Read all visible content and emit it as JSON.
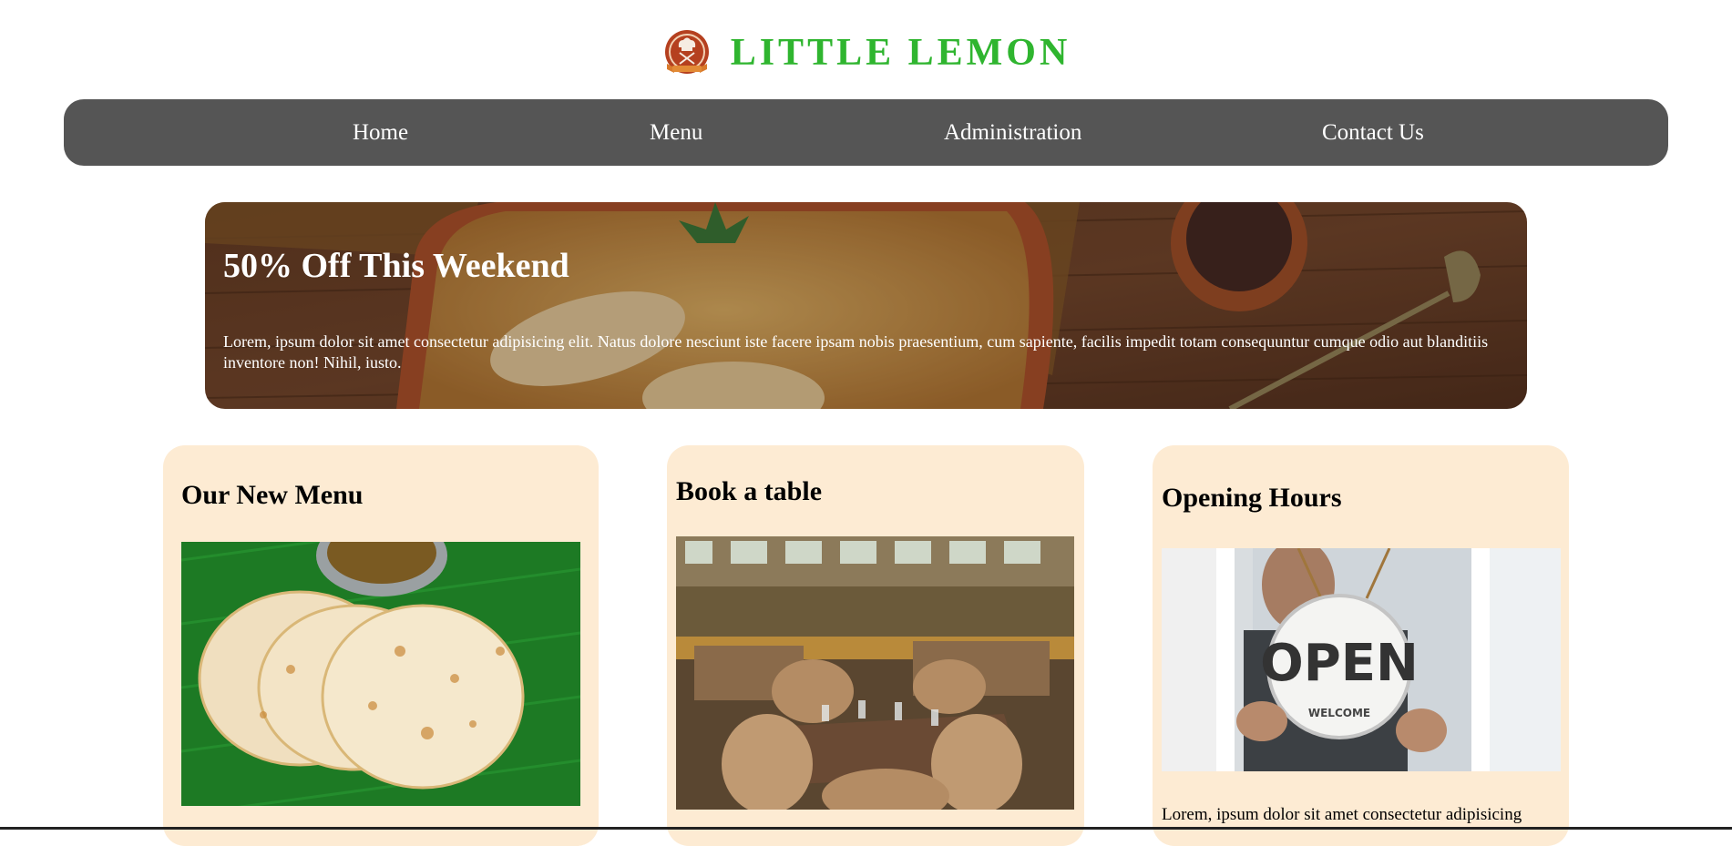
{
  "brand": {
    "name": "LITTLE LEMON",
    "logo_icon": "chef-logo-icon",
    "color": "#2fb52f"
  },
  "nav": {
    "items": [
      {
        "label": "Home"
      },
      {
        "label": "Menu"
      },
      {
        "label": "Administration"
      },
      {
        "label": "Contact Us"
      }
    ],
    "background": "#555555"
  },
  "banner": {
    "title": "50% Off This Weekend",
    "text": "Lorem, ipsum dolor sit amet consectetur adipisicing elit. Natus dolore nesciunt iste facere ipsam nobis praesentium, cum sapiente, facilis impedit totam consequuntur cumque odio aut blanditiis inventore non! Nihil, iusto."
  },
  "cards": [
    {
      "title": "Our New Menu",
      "image": "parotta-dish-image"
    },
    {
      "title": "Book a table",
      "image": "restaurant-interior-image"
    },
    {
      "title": "Opening Hours",
      "image": "open-sign-image",
      "text": "Lorem, ipsum dolor sit amet consectetur adipisicing"
    }
  ],
  "colors": {
    "card_background": "#fdebd3"
  }
}
